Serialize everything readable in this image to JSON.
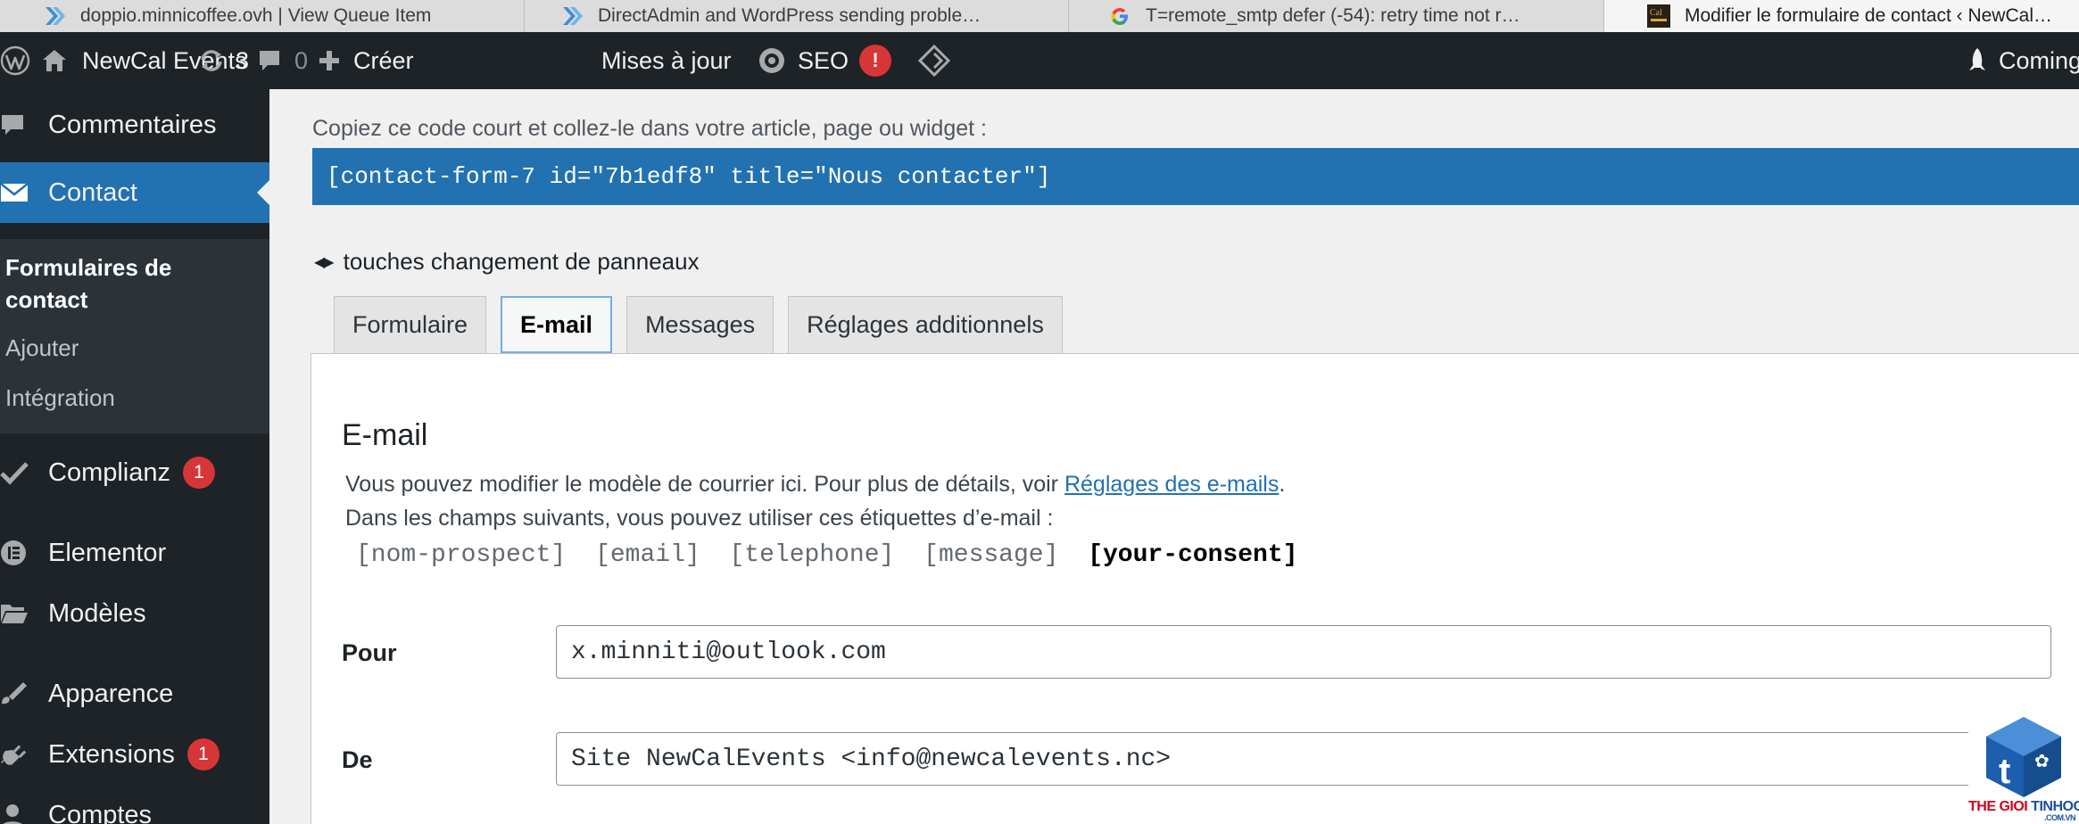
{
  "browser": {
    "tabs": [
      {
        "title": "doppio.minnicoffee.ovh | View Queue Item",
        "icon": "directadmin-icon",
        "active": false
      },
      {
        "title": "DirectAdmin and WordPress sending proble…",
        "icon": "directadmin-icon",
        "active": false
      },
      {
        "title": "T=remote_smtp defer (-54): retry time not r…",
        "icon": "google-icon",
        "active": false
      },
      {
        "title": "Modifier le formulaire de contact ‹ NewCal…",
        "icon": "site-favicon",
        "active": true
      }
    ]
  },
  "adminbar": {
    "site_name": "NewCal Events",
    "updates_count": "3",
    "comments_count": "0",
    "create_label": "Créer",
    "updates_label": "Mises à jour",
    "seo_label": "SEO",
    "seo_badge": "!",
    "coming_soon_label": "Coming"
  },
  "sidebar": {
    "comments_label": "Commentaires",
    "contact_label": "Contact",
    "submenu": {
      "forms_line1": "Formulaires de",
      "forms_line2": "contact",
      "add_label": "Ajouter",
      "integration_label": "Intégration"
    },
    "complianz_label": "Complianz",
    "complianz_badge": "1",
    "elementor_label": "Elementor",
    "models_label": "Modèles",
    "appearance_label": "Apparence",
    "extensions_label": "Extensions",
    "extensions_badge": "1",
    "accounts_label": "Comptes"
  },
  "main": {
    "shortcode_label": "Copiez ce code court et collez-le dans votre article, page ou widget :",
    "shortcode": "[contact-form-7 id=\"7b1edf8\" title=\"Nous contacter\"]",
    "panel_keys_label": "touches changement de panneaux",
    "tabs": [
      "Formulaire",
      "E-mail",
      "Messages",
      "Réglages additionnels"
    ],
    "active_tab": "E-mail",
    "email_panel": {
      "title": "E-mail",
      "intro_text": "Vous pouvez modifier le modèle de courrier ici. Pour plus de détails, voir ",
      "intro_link": "Réglages des e-mails",
      "intro_end": ".",
      "tags_intro": "Dans les champs suivants, vous pouvez utiliser ces étiquettes d’e-mail :",
      "tags": [
        "[nom-prospect]",
        "[email]",
        "[telephone]",
        "[message]"
      ],
      "strong_tag": "[your-consent]",
      "fields": [
        {
          "label": "Pour",
          "value": "x.minniti@outlook.com"
        },
        {
          "label": "De",
          "value": "Site NewCalEvents <info@newcalevents.nc>"
        }
      ]
    }
  },
  "watermark": {
    "text_red": "THE GIOI ",
    "text_blue": "TINHOC",
    "small": ".COM.VN"
  },
  "colors": {
    "admin_dark": "#1d2327",
    "accent_blue": "#2271b1",
    "badge_red": "#d63638"
  }
}
